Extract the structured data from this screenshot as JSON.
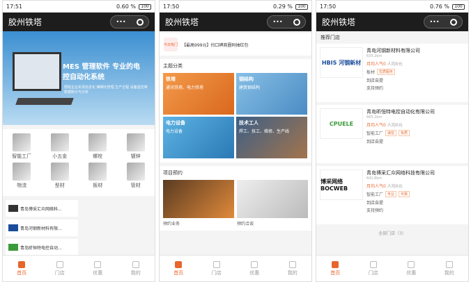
{
  "app_title": "胶州铁塔",
  "phones": [
    {
      "time": "17:51",
      "signal": "0.60 %",
      "battery": "100"
    },
    {
      "time": "17:50",
      "signal": "0.29 %",
      "battery": "100"
    },
    {
      "time": "17:50",
      "signal": "0.76 %",
      "battery": "100"
    }
  ],
  "tabs": [
    "首页",
    "门店",
    "优惠",
    "我的"
  ],
  "banner": {
    "title": "MES 管理软件 专业的电控自动化系统",
    "subtitle": "帮助企业实现信息化 精细化管理 生产过程 设备监控等 数据统计与分析"
  },
  "grid_items": [
    "智能工厂",
    "小五金",
    "螺栓",
    "镀锌",
    "物流",
    "型材",
    "板材",
    "管材"
  ],
  "shops_row": [
    "青岛博采汇众网络科…",
    "青岛河钢新材料有限…",
    "青岛昕恒特电控自动…"
  ],
  "promo": {
    "badge": "今日热门",
    "text": "【最高999元】扫口碑商圈码抽红包"
  },
  "category_section": "主题分类",
  "categories": [
    {
      "title": "铁塔",
      "desc": "通讯铁塔、电力铁塔"
    },
    {
      "title": "钢结构",
      "desc": "建筑钢结构"
    },
    {
      "title": "电力设备",
      "desc": "电力设备"
    },
    {
      "title": "技术工人",
      "desc": "焊工、技工、维修、生产线"
    }
  ],
  "project_section": "项目预约",
  "projects": [
    "预约业务",
    "预约洽谈"
  ],
  "recommend_title": "推荐门店",
  "stores": [
    {
      "name": "青岛河钢新材料有限公司",
      "logo": "HBIS 河钢新材",
      "dist": "635.2km",
      "pop": "月均人气0",
      "price": "人均0元",
      "category": "板材",
      "tags": [
        "优质服务"
      ],
      "features": [
        "到店自提",
        "支持预约"
      ]
    },
    {
      "name": "青岛昕恒特电控自动化有限公司",
      "logo": "CPUELE",
      "dist": "665.2km",
      "pop": "月均人气0",
      "price": "人均0元",
      "category": "智能工厂",
      "tags": [
        "诚信",
        "有质"
      ],
      "features": [
        "到店自提"
      ]
    },
    {
      "name": "青岛博采汇众网络科技有限公司",
      "logo": "博采网络 BOCWEB",
      "dist": "641.8km",
      "pop": "月均人气0",
      "price": "人均0元",
      "category": "智能工厂",
      "tags": [
        "专业",
        "可靠"
      ],
      "features": [
        "到店自提",
        "支持预约"
      ]
    }
  ],
  "all_stores": "全部门店（3）"
}
